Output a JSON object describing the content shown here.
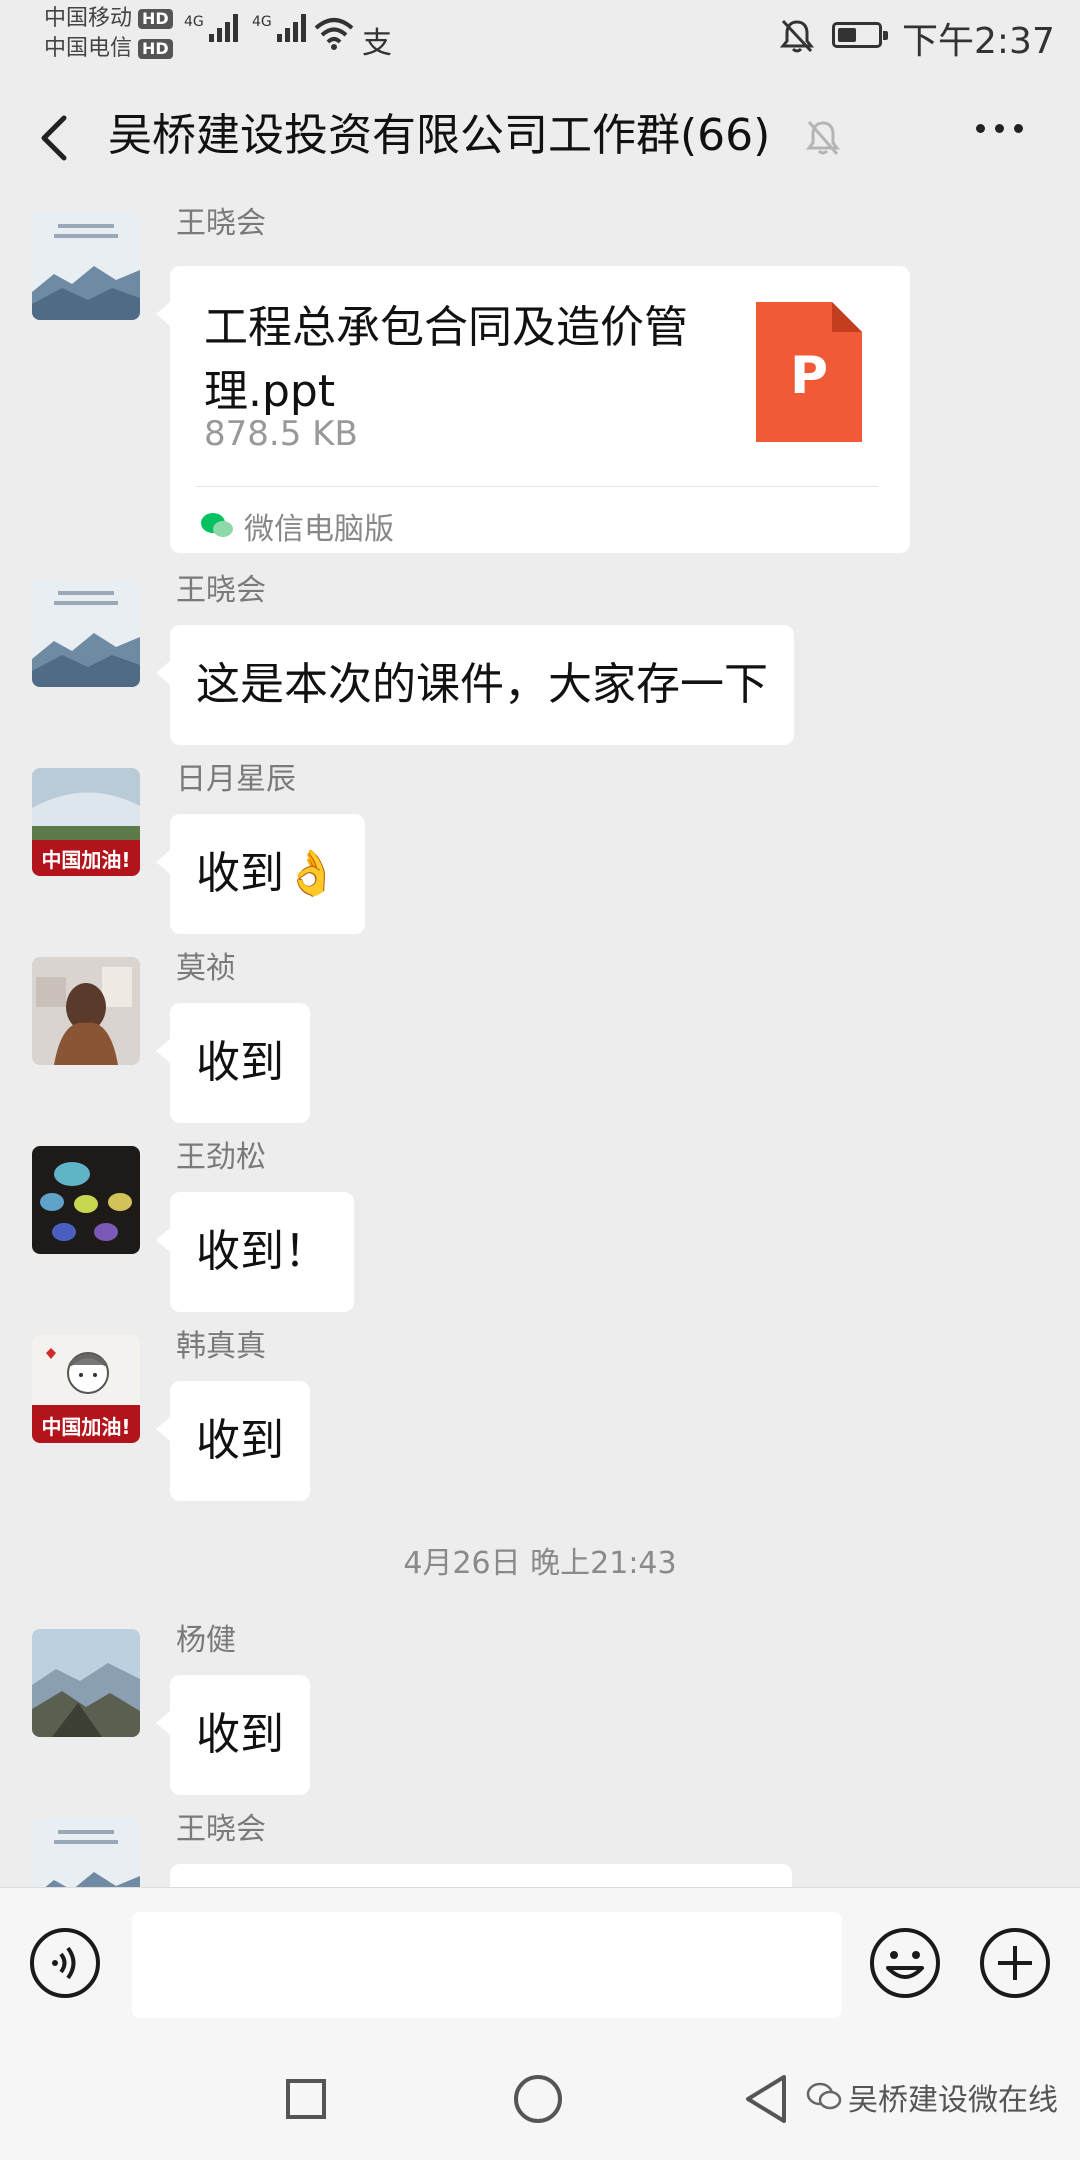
{
  "status_bar": {
    "carrier1": "中国移动",
    "carrier2": "中国电信",
    "hd_badge": "HD",
    "network1": "4G",
    "network2": "4G",
    "pay_icon": "支",
    "time": "下午2:37"
  },
  "nav": {
    "title": "吴桥建设投资有限公司工作群(66)"
  },
  "messages": [
    {
      "sender": "王晓会",
      "type": "file",
      "file_name": "工程总承包合同及造价管理.ppt",
      "file_size": "878.5 KB",
      "file_type_letter": "P",
      "source": "微信电脑版"
    },
    {
      "sender": "王晓会",
      "type": "text",
      "text": "这是本次的课件，大家存一下"
    },
    {
      "sender": "日月星辰",
      "type": "text",
      "text": "收到👌"
    },
    {
      "sender": "莫祯",
      "type": "text",
      "text": "收到"
    },
    {
      "sender": "王劲松",
      "type": "text",
      "text": "收到！"
    },
    {
      "sender": "韩真真",
      "type": "text",
      "text": "收到"
    },
    {
      "sender": "杨健",
      "type": "text",
      "text": "收到"
    },
    {
      "sender": "王晓会",
      "type": "text",
      "text": ""
    }
  ],
  "timestamp": "4月26日 晚上21:43",
  "avatar_badges": {
    "badge": "中国加油!"
  },
  "watermark": "吴桥建设微在线",
  "colors": {
    "chat_bg": "#ededed",
    "bubble": "#ffffff",
    "ppt_orange": "#f05a36",
    "wechat_green": "#07c160"
  }
}
